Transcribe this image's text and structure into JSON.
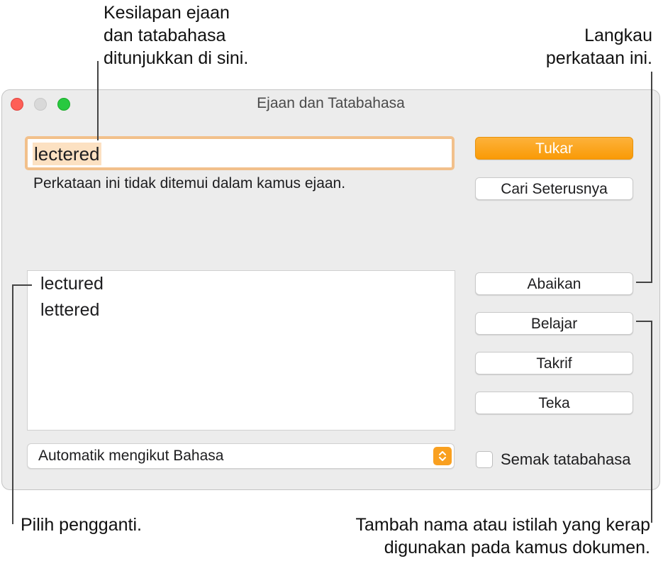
{
  "callouts": {
    "errors": [
      "Kesilapan ejaan",
      "dan tatabahasa",
      "ditunjukkan di sini."
    ],
    "ignore": [
      "Langkau",
      "perkataan ini."
    ],
    "choose": "Pilih pengganti.",
    "learn": [
      "Tambah nama atau istilah yang kerap",
      "digunakan pada kamus dokumen."
    ]
  },
  "window": {
    "title": "Ejaan dan Tatabahasa",
    "misspelled_word": "lectered",
    "status_message": "Perkataan ini tidak ditemui dalam kamus ejaan.",
    "suggestions": [
      "lectured",
      "lettered"
    ],
    "buttons": {
      "change": "Tukar",
      "find_next": "Cari Seterusnya",
      "ignore": "Abaikan",
      "learn": "Belajar",
      "define": "Takrif",
      "guess": "Teka"
    },
    "language": "Automatik mengikut Bahasa",
    "check_grammar": "Semak tatabahasa",
    "check_grammar_checked": false
  },
  "colors": {
    "accent": "#f99a06",
    "selection": "#fce1c2",
    "focus_ring": "#f2c08b"
  },
  "icons": {
    "select": "up-down-chevron-icon"
  }
}
